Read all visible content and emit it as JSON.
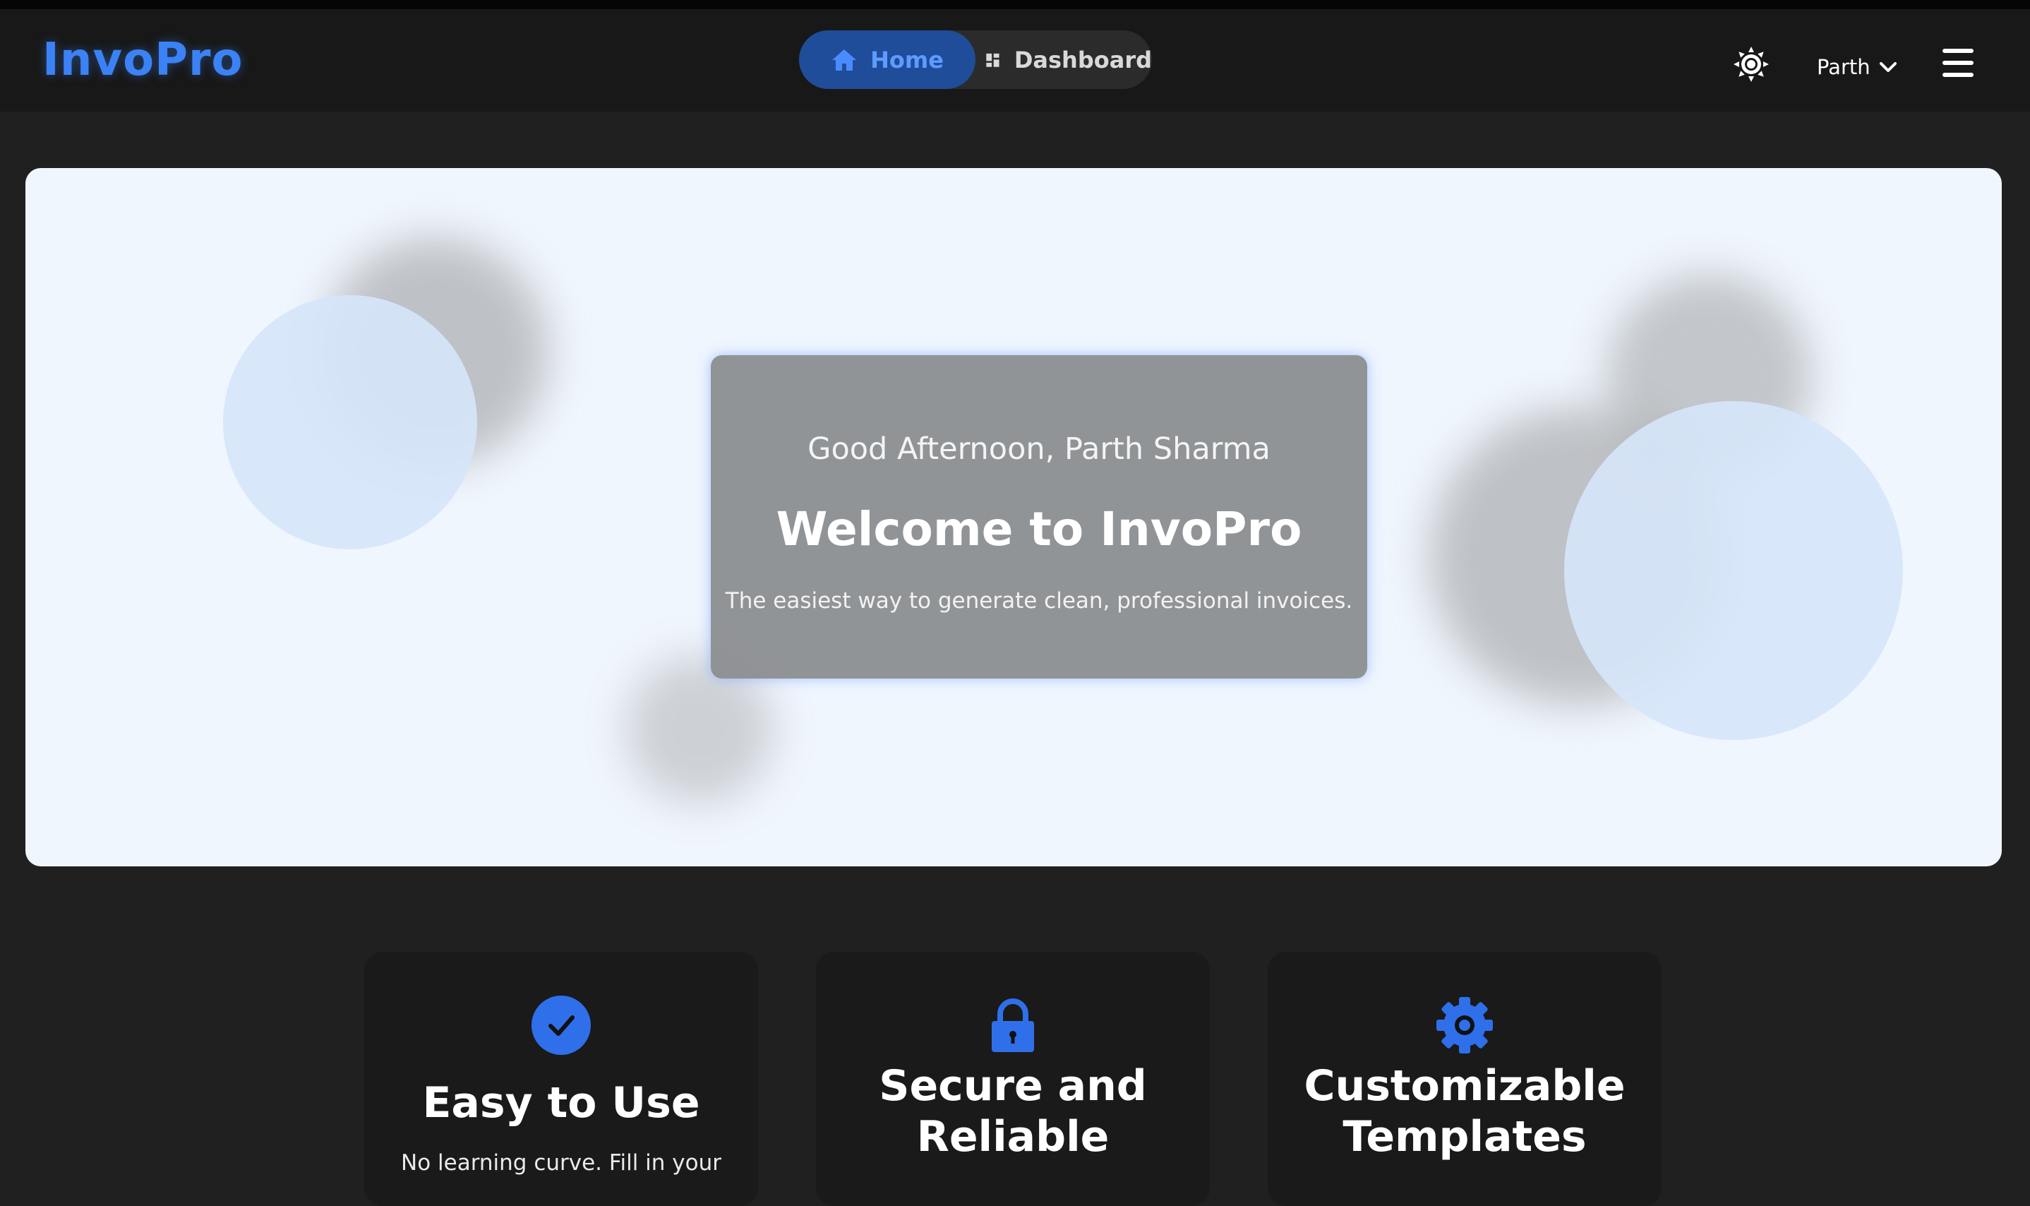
{
  "brand": {
    "name": "InvoPro",
    "color": "#3b82f6"
  },
  "nav": {
    "home_label": "Home",
    "dashboard_label": "Dashboard",
    "active": "Home"
  },
  "header": {
    "theme_toggle_icon": "sun-icon",
    "user_name": "Parth",
    "menu_icon": "hamburger-icon"
  },
  "hero": {
    "greeting": "Good Afternoon, Parth Sharma",
    "title": "Welcome to InvoPro",
    "subtitle": "The easiest way to generate clean, professional invoices."
  },
  "features": [
    {
      "icon": "check-circle-icon",
      "title": "Easy to Use",
      "description": "No learning curve. Fill in your"
    },
    {
      "icon": "lock-icon",
      "title": "Secure and Reliable",
      "description": ""
    },
    {
      "icon": "gear-icon",
      "title": "Customizable Templates",
      "description": ""
    }
  ],
  "colors": {
    "accent": "#3b82f6",
    "page_background": "#202020",
    "navbar_background": "#181818",
    "hero_background": "#f0f6fe",
    "card_background": "#1a1a1a"
  }
}
